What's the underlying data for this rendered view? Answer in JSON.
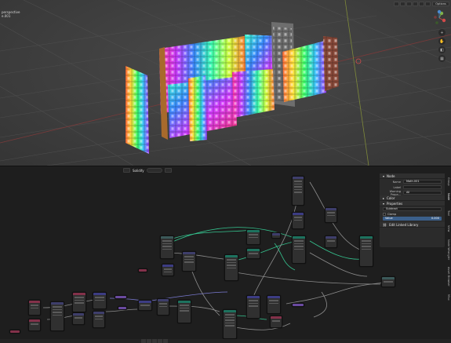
{
  "viewport": {
    "info_line_1": "perspective",
    "info_line_2": "e.001",
    "options_label": "Options",
    "gizmo_axes": {
      "x": "X",
      "y": "Y",
      "z": "Z"
    },
    "nav_icons": [
      "zoom-icon",
      "hand-icon",
      "camera-icon",
      "grid-icon"
    ]
  },
  "node_editor": {
    "tree_name": "Solidify"
  },
  "sidebar": {
    "node_section": "Node",
    "name_label": "Name",
    "name_value": "Math.001",
    "label_label": "Label",
    "label_value": "",
    "warning_label": "Warning Propa...",
    "warning_value": "All",
    "color_label": "Color",
    "properties_section": "Properties",
    "operation_value": "Subtract",
    "clamp_label": "Clamp",
    "value_label": "Value",
    "value_value": "0.000",
    "linked_library": "Edit Linked Library",
    "tabs": [
      "Group",
      "Node",
      "Tool",
      "View",
      "Node Wrangler",
      "Asset Browser",
      "Misc"
    ]
  },
  "colors": {
    "accent": "#3b5f8a",
    "geometry_node_header": "#1d725e",
    "math_node_header": "#3e3e6b",
    "input_node_header": "#83314a",
    "group_node_header": "#3b5959",
    "vector_node_header": "#3c3c83"
  }
}
